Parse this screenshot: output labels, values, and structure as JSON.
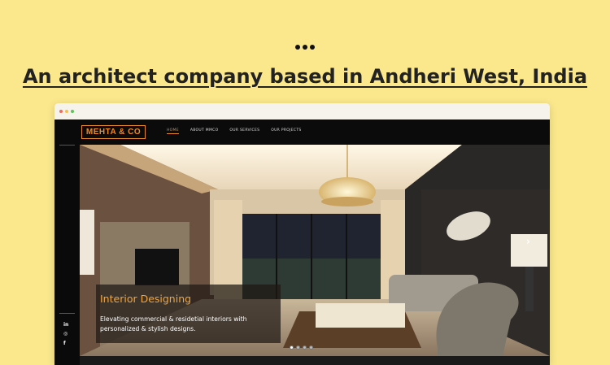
{
  "headline": "An architect company based in Andheri West, India",
  "browser": {
    "dot_colors": [
      "#f26b5b",
      "#f7c04a",
      "#5fc45a"
    ]
  },
  "site": {
    "logo": "MEHTA & CO",
    "nav": [
      "HOME",
      "ABOUT MMCO",
      "OUR SERVICES",
      "OUR PROJECTS"
    ],
    "social": [
      "in",
      "◎",
      "f"
    ],
    "hero": {
      "title": "Interior Designing",
      "text": "Elevating commercial & residetial interiors with personalized & stylish designs.",
      "next_arrow": "›",
      "slide_count": 4,
      "active_slide": 1
    },
    "accent_color": "#f08a24"
  }
}
